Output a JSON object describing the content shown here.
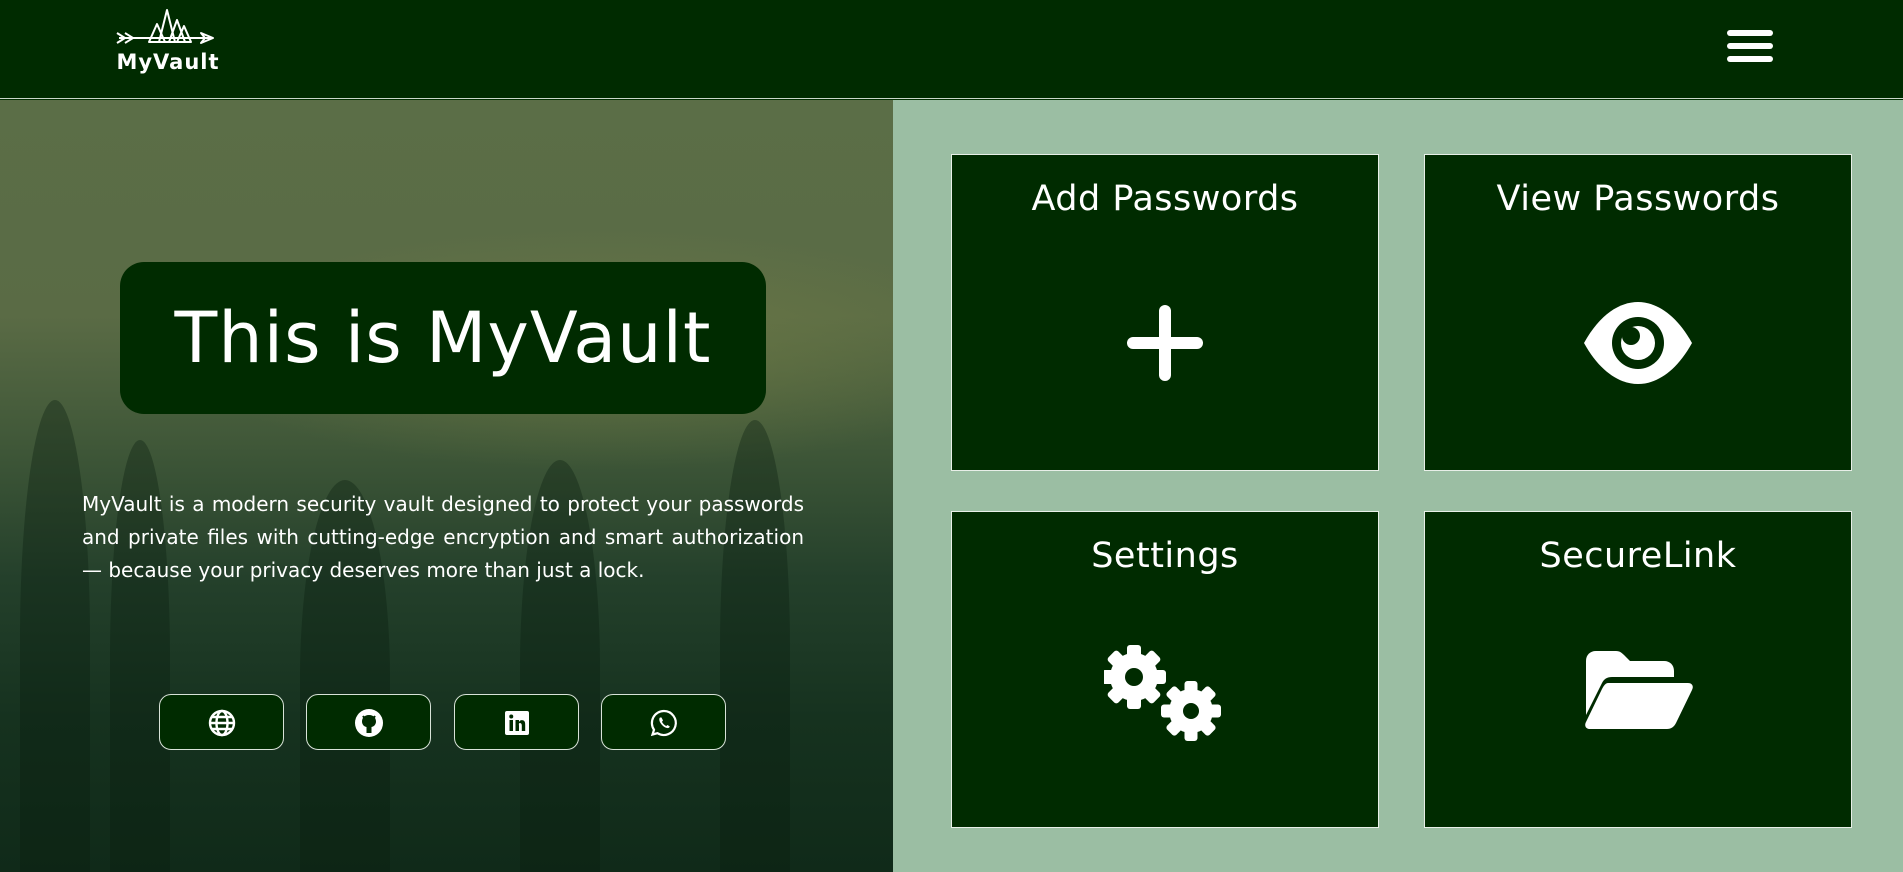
{
  "header": {
    "logo_text": "MyVault",
    "logo_icon": "trees-arrow-logo",
    "menu_icon": "hamburger-menu-icon"
  },
  "hero": {
    "title": "This is MyVault",
    "description": "MyVault is a modern security vault designed to protect your passwords and private files with cutting-edge encryption and smart authorization — because your privacy deserves more than just a lock.",
    "social_links": [
      {
        "icon": "globe-icon"
      },
      {
        "icon": "github-icon"
      },
      {
        "icon": "linkedin-icon"
      },
      {
        "icon": "whatsapp-icon"
      }
    ]
  },
  "cards": [
    {
      "title": "Add Passwords",
      "icon": "plus-icon"
    },
    {
      "title": "View Passwords",
      "icon": "eye-icon"
    },
    {
      "title": "Settings",
      "icon": "gears-icon"
    },
    {
      "title": "SecureLink",
      "icon": "folder-open-icon"
    }
  ],
  "colors": {
    "primary_dark_green": "#002b00",
    "panel_sage": "#9bbea3",
    "text_white": "#ffffff"
  }
}
